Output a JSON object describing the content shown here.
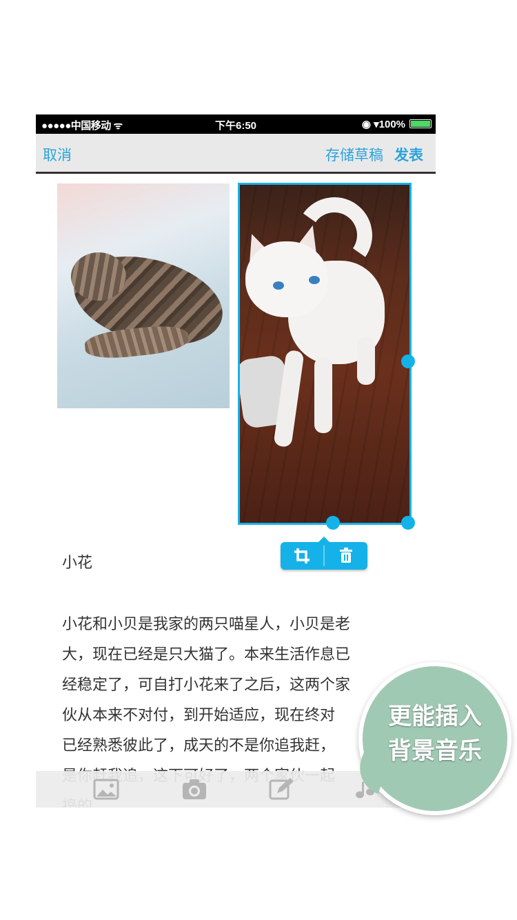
{
  "status_bar": {
    "carrier": "●●●●●中国移动 ᯤ",
    "time": "下午6:50",
    "indicators": "◉ ▾100%"
  },
  "nav": {
    "cancel": "取消",
    "save_draft": "存储草稿",
    "publish": "发表"
  },
  "photos": [
    {
      "subject": "tabby kitten sleeping"
    },
    {
      "subject": "white cat with blue eyes",
      "selected": true
    }
  ],
  "image_toolbar": {
    "crop_icon": "crop-icon",
    "delete_icon": "trash-icon"
  },
  "post": {
    "title": "小花",
    "body": "小花和小贝是我家的两只喵星人，小贝是老\n大，现在已经是只大猫了。本来生活作息已\n经稳定了，可自打小花来了之后，这两个家\n伙从本来不对付，到开始适应，现在终对\n已经熟悉彼此了，成天的不是你追我赶，\n是你赶我追，这下可好了，两个家伙一起\n捣的"
  },
  "bottom_toolbar": [
    "image-icon",
    "camera-icon",
    "edit-icon",
    "music-icon"
  ],
  "promo_bubble": {
    "line1": "更能插入",
    "line2": "背景音乐"
  },
  "colors": {
    "accent": "#14b2e8",
    "nav_text": "#2ba3db",
    "bubble": "#a0c9b4"
  }
}
